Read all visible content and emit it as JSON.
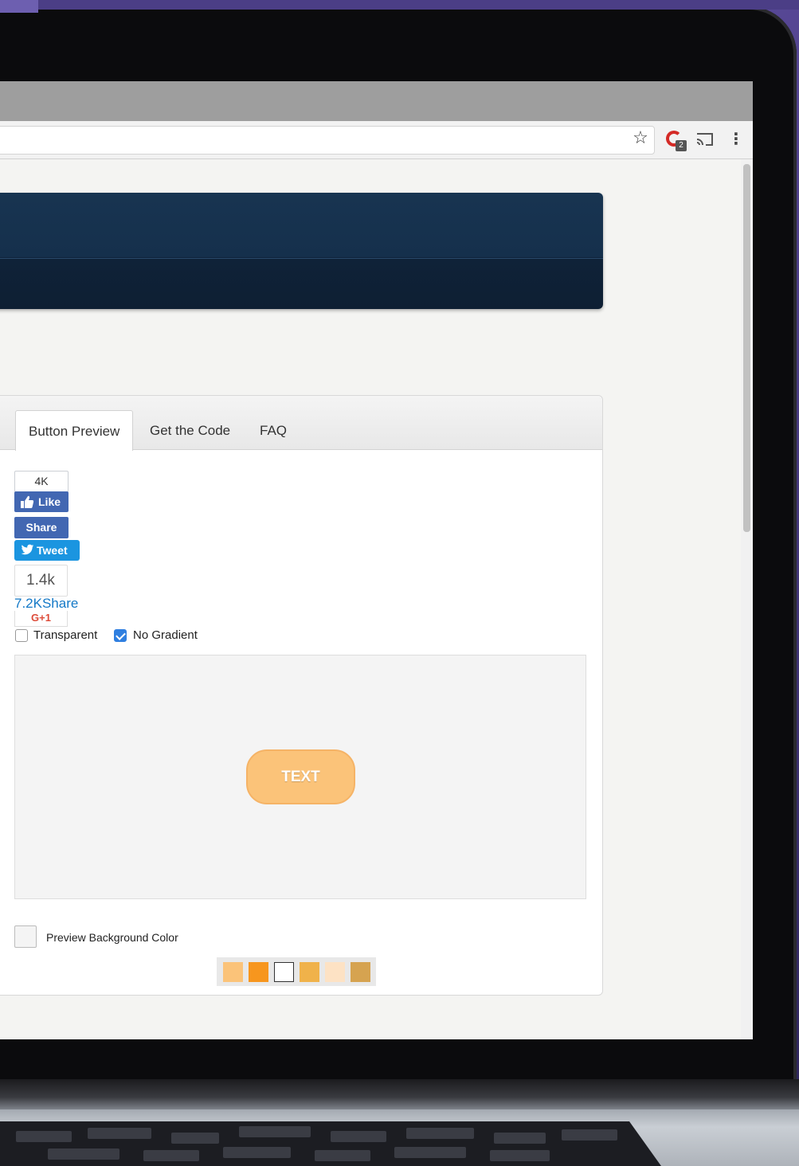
{
  "browser": {
    "star_glyph": "☆",
    "extension_badge": "2",
    "menu_glyph": "⋮"
  },
  "tabs": [
    {
      "label": "Button Preview",
      "active": true
    },
    {
      "label": "Get the Code",
      "active": false
    },
    {
      "label": "FAQ",
      "active": false
    }
  ],
  "social": {
    "fb_count": "4K",
    "fb_like_label": "Like",
    "fb_share_label": "Share",
    "tweet_label": "Tweet",
    "linkedin_count": "1.4k",
    "share_count_link": "7.2KShare",
    "gplus_label": "G+1"
  },
  "options": {
    "transparent_label": "Transparent",
    "transparent_checked": false,
    "no_gradient_label": "No Gradient",
    "no_gradient_checked": true
  },
  "preview": {
    "button_text": "TEXT",
    "button_color": "#fbc379"
  },
  "background": {
    "label": "Preview Background Color"
  },
  "swatches": [
    "#fbc379",
    "#f7961e",
    "#ffffff",
    "#f0b24a",
    "#fde2c4",
    "#d6a350"
  ],
  "colors": {
    "hero": "#15304c",
    "fb_blue": "#4267b2",
    "twitter_blue": "#1b95e0",
    "gplus_red": "#dd4b39",
    "checkbox_blue": "#2f7fe0"
  }
}
